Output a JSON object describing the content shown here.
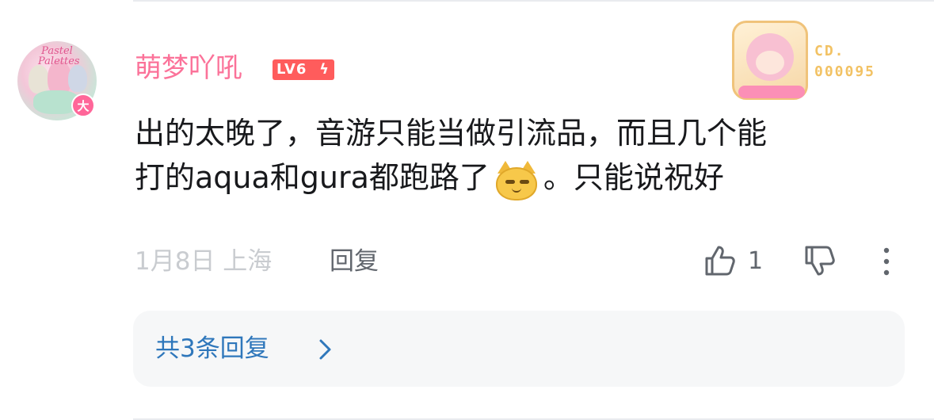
{
  "comment": {
    "avatar": {
      "logo_text": "Pastel Palettes",
      "badge_label": "大"
    },
    "username": "萌梦吖吼",
    "level_label": "LV6",
    "card_decoration": {
      "line1": "CD.",
      "line2": "000095"
    },
    "content": {
      "line1": "出的太晚了，音游只能当做引流品，而且几个能",
      "line2_before_emoji": "打的aqua和gura都跑路了",
      "emoji_name": "cat-emoji",
      "line2_after_emoji": "。只能说祝好"
    },
    "date_location": "1月8日 上海",
    "reply_label": "回复",
    "like_count": "1",
    "replies_summary": "共3条回复"
  },
  "colors": {
    "username": "#fb7299",
    "level_badge": "#ff5c5c",
    "link": "#2f77bb",
    "meta": "#c9ccd0",
    "card_number": "#f2c264"
  }
}
